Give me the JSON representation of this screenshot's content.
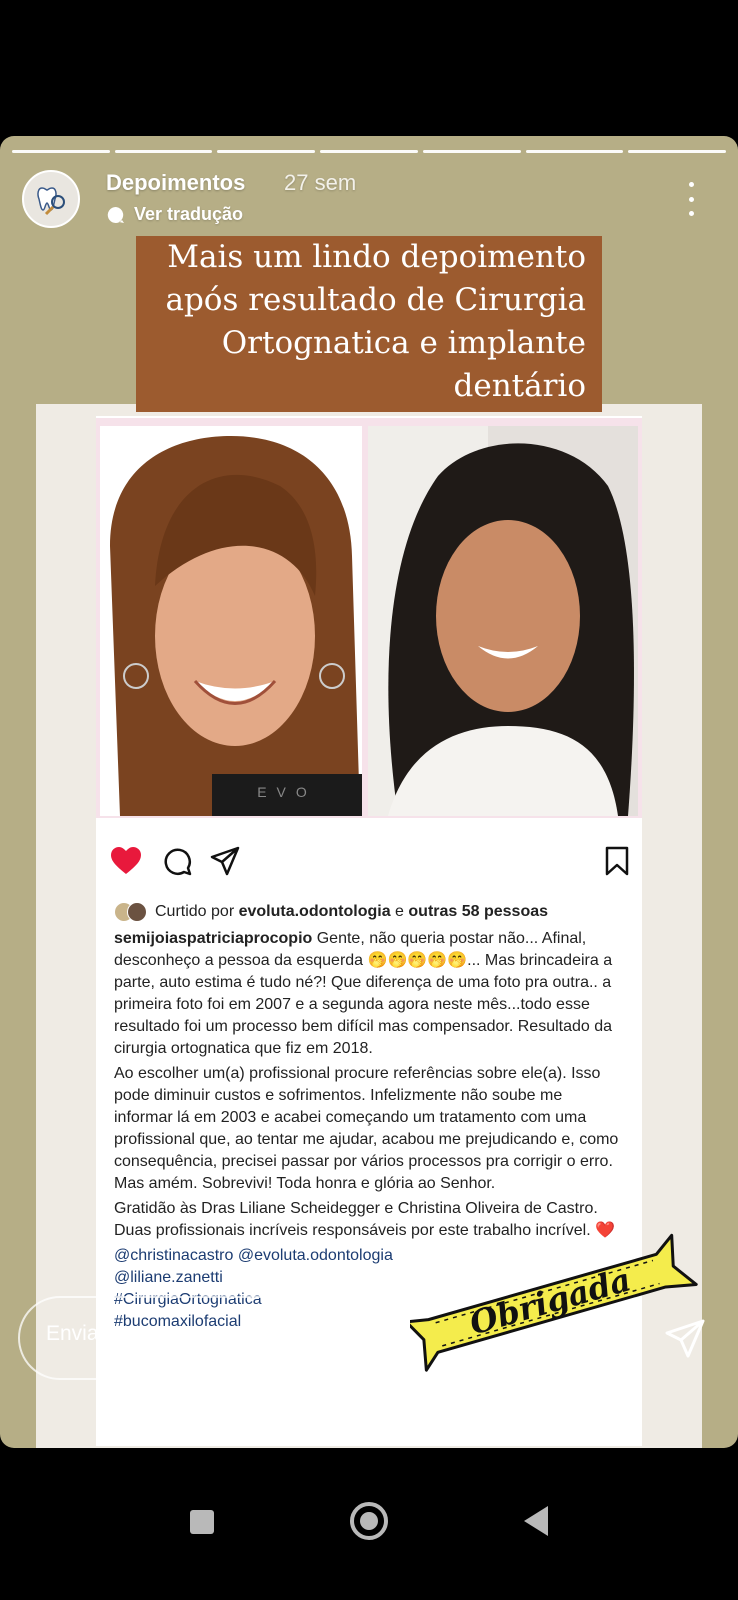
{
  "story": {
    "account_name": "Depoimentos",
    "time_ago": "27 sem",
    "translate_label": "Ver tradução",
    "banner_lines": [
      "Mais um lindo depoimento",
      "após resultado de Cirurgia",
      "Ortognatica e implante",
      "dentário"
    ],
    "progress_segments": 7
  },
  "post": {
    "photo_logo_text": "EVO",
    "likes": {
      "prefix": "Curtido por ",
      "user": "evoluta.odontologia",
      "middle": " e ",
      "others": "outras 58 pessoas"
    },
    "caption": {
      "user": "semijoiaspatriciaprocopio",
      "para1": " Gente, não queria postar não... Afinal, desconheço a pessoa da esquerda 🤭🤭🤭🤭🤭... Mas brincadeira a parte, auto estima é tudo né?! Que diferença de uma foto pra outra.. a primeira foto foi em 2007 e a segunda agora neste mês...todo esse resultado foi um processo bem difícil mas compensador. Resultado da cirurgia ortognatica que fiz em 2018.",
      "para2": "Ao escolher um(a) profissional procure referências sobre ele(a). Isso pode diminuir custos e sofrimentos. Infelizmente não soube me informar lá em 2003 e acabei começando um tratamento com uma profissional que, ao tentar me ajudar, acabou me prejudicando e, como consequência, precisei passar por vários processos pra corrigir o erro. Mas amém. Sobrevivi! Toda honra e glória ao Senhor.",
      "para3": "Gratidão às Dras Liliane Scheidegger e Christina Oliveira de Castro. Duas profissionais incríveis responsáveis por este trabalho incrível. ",
      "heart": "❤️",
      "tags": [
        "@christinacastro @evoluta.odontologia",
        "@liliane.zanetti",
        "#CirurgiaOrtognatica",
        "#bucomaxilofacial"
      ]
    }
  },
  "sticker": {
    "text": "Obrigada"
  },
  "footer": {
    "message_placeholder": "Enviar mensagem"
  },
  "colors": {
    "story_bg": "#b6ae86",
    "banner_bg": "#9c5b2f",
    "sticker_yellow": "#f4ec4c",
    "like_red": "#e8193c"
  }
}
